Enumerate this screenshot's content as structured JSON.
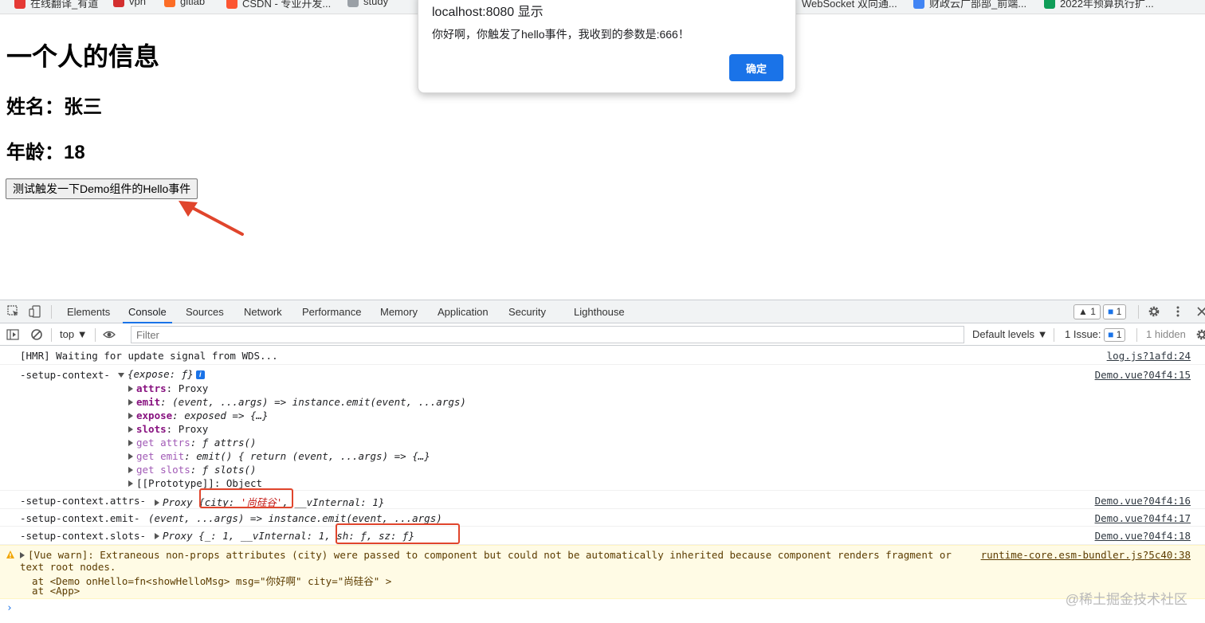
{
  "bookmarks": [
    {
      "label": "在线翻译_有道",
      "color": "#e53935"
    },
    {
      "label": "vpn",
      "color": "#d32f2f"
    },
    {
      "label": "gitlab",
      "color": "#fc6d26"
    },
    {
      "label": "CSDN - 专业开发...",
      "color": "#fc5531"
    },
    {
      "label": "study",
      "color": "#9aa0a6"
    },
    {
      "label": "WebSocket 双向通...",
      "color": "#9aa0a6"
    },
    {
      "label": "财政云广部部_前端...",
      "color": "#4285f4"
    },
    {
      "label": "2022年预算执行扩...",
      "color": "#0f9d58"
    }
  ],
  "page": {
    "title": "一个人的信息",
    "name_line": "姓名：张三",
    "age_line": "年龄：18",
    "button_label": "测试触发一下Demo组件的Hello事件"
  },
  "alert": {
    "title": "localhost:8080 显示",
    "message": "你好啊，你触发了hello事件，我收到的参数是:666！",
    "ok_label": "确定"
  },
  "devtools": {
    "tabs": [
      "Elements",
      "Console",
      "Sources",
      "Network",
      "Performance",
      "Memory",
      "Application",
      "Security",
      "Lighthouse"
    ],
    "active_tab": "Console",
    "warnings_badge": "1",
    "messages_badge": "1",
    "toolbar": {
      "context": "top",
      "filter_placeholder": "Filter",
      "levels": "Default levels",
      "issues": "1 Issue:",
      "issues_count": "1",
      "hidden": "1 hidden"
    },
    "console": {
      "hmr": {
        "text": "[HMR] Waiting for update signal from WDS...",
        "source": "log.js?1afd:24"
      },
      "ctx": {
        "label": "-setup-context-",
        "summary": "{expose: ƒ}",
        "source": "Demo.vue?04f4:15",
        "props": [
          {
            "key": "attrs",
            "value": ": Proxy",
            "kind": "own"
          },
          {
            "key": "emit",
            "value": ": (event, ...args) => instance.emit(event, ...args)",
            "kind": "own"
          },
          {
            "key": "expose",
            "value": ": exposed => {…}",
            "kind": "own"
          },
          {
            "key": "slots",
            "value": ": Proxy",
            "kind": "own"
          },
          {
            "key": "get attrs",
            "value": ": ƒ attrs()",
            "kind": "get"
          },
          {
            "key": "get emit",
            "value": ": emit() { return (event, ...args) => {…}",
            "kind": "get"
          },
          {
            "key": "get slots",
            "value": ": ƒ slots()",
            "kind": "get"
          },
          {
            "key": "[[Prototype]]",
            "value": ": Object",
            "kind": "proto"
          }
        ]
      },
      "attrs": {
        "label": "-setup-context.attrs-",
        "proxy": "Proxy",
        "brace_open": "{city: ",
        "city": "'尚硅谷'",
        "rest": ", __vInternal: 1}",
        "source": "Demo.vue?04f4:16"
      },
      "emit": {
        "label": "-setup-context.emit-",
        "value": "(event, ...args) => instance.emit(event, ...args)",
        "source": "Demo.vue?04f4:17"
      },
      "slots": {
        "label": "-setup-context.slots-",
        "proxy": "Proxy",
        "part1": "{_: 1, __vInternal: 1, ",
        "part2": "sh: ƒ, sz: ƒ}",
        "source": "Demo.vue?04f4:18"
      },
      "warn": {
        "line1": "[Vue warn]: Extraneous non-props attributes (city) were passed to component but could not be automatically inherited because component renders fragment or",
        "line2": "text root nodes.",
        "line3": "  at <Demo onHello=fn<showHelloMsg> msg=\"你好啊\" city=\"尚硅谷\" >",
        "line4": "  at <App>",
        "source": "runtime-core.esm-bundler.js?5c40:38"
      },
      "prompt": "›"
    }
  },
  "watermark": "@稀土掘金技术社区"
}
